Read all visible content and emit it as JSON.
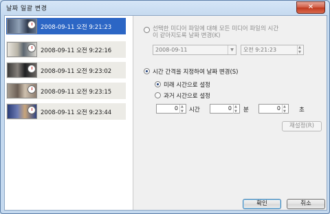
{
  "window": {
    "title": "날짜 일괄 변경",
    "close_label": "✕"
  },
  "photos": [
    {
      "timestamp": "2008-09-11 오전 9:21:23",
      "selected": true
    },
    {
      "timestamp": "2008-09-11 오전 9:22:16",
      "selected": false
    },
    {
      "timestamp": "2008-09-11 오전 9:23:02",
      "selected": false
    },
    {
      "timestamp": "2008-09-11 오전 9:23:15",
      "selected": false
    },
    {
      "timestamp": "2008-09-11 오전 9:23:44",
      "selected": false
    }
  ],
  "option_same_time": {
    "label_line1": "선택한 미디어 파일에 대해 모든 미디어 파일의 시간",
    "label_line2": "이 같아지도록 날짜 변경(K)",
    "date_value": "2008-09-11",
    "time_value": "오전  9:21:23",
    "selected": false
  },
  "option_interval": {
    "label": "시간 간격을 지정하여 날짜 변경(S)",
    "selected": true,
    "future_label": "미래 시간으로 설정",
    "past_label": "과거 시간으로 설정",
    "future_selected": true,
    "hours_value": "0",
    "hours_unit": "시간",
    "minutes_value": "0",
    "minutes_unit": "분",
    "seconds_value": "0",
    "seconds_unit": "초"
  },
  "buttons": {
    "reset": "재설정(R)",
    "ok": "확인",
    "cancel": "취소"
  },
  "colors": {
    "selection": "#2c66c5",
    "window_frame": "#c4d9ef",
    "close": "#c0391f"
  },
  "icons": [
    "clock-icon",
    "close-icon",
    "spin-up-icon",
    "spin-down-icon",
    "calendar-dropdown-icon"
  ]
}
